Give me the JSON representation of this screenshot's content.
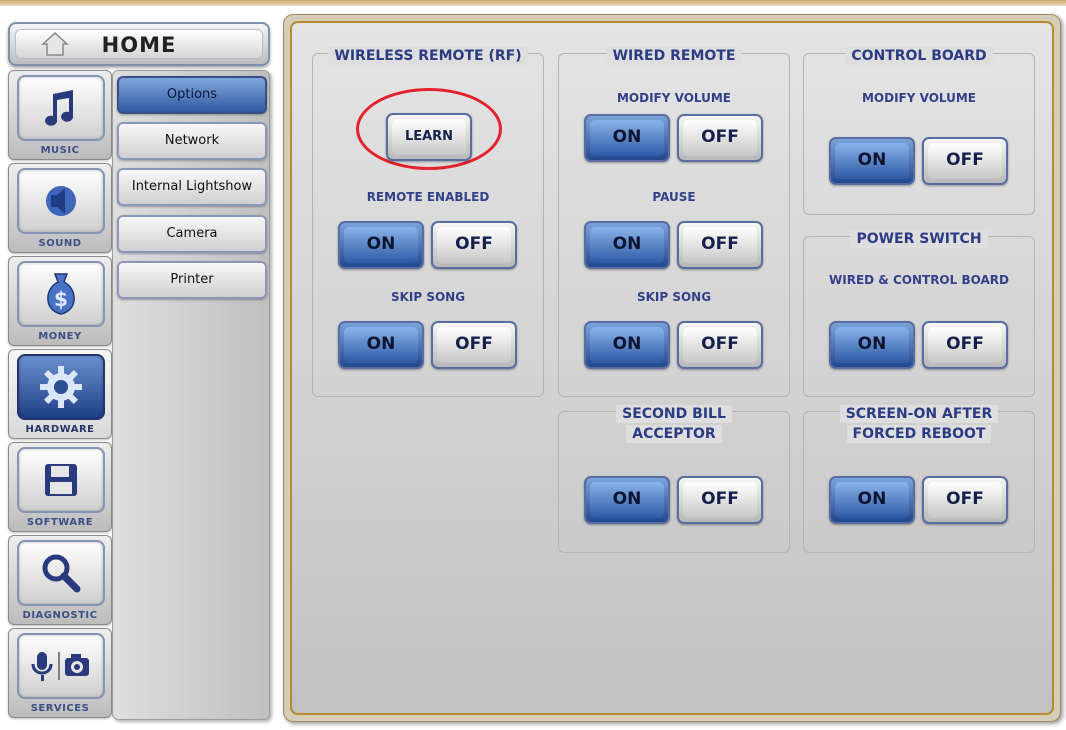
{
  "home": {
    "label": "HOME",
    "icon": "home-icon"
  },
  "categories": [
    {
      "label": "MUSIC",
      "icon": "music-icon"
    },
    {
      "label": "SOUND",
      "icon": "speaker-icon"
    },
    {
      "label": "MONEY",
      "icon": "money-bag-icon"
    },
    {
      "label": "HARDWARE",
      "icon": "gear-icon"
    },
    {
      "label": "SOFTWARE",
      "icon": "floppy-disk-icon"
    },
    {
      "label": "DIAGNOSTIC",
      "icon": "magnifier-icon"
    },
    {
      "label": "SERVICES",
      "icon": "mic-camera-icon"
    }
  ],
  "submenu": [
    "Options",
    "Network",
    "Internal Lightshow",
    "Camera",
    "Printer"
  ],
  "groups": {
    "wireless": {
      "title": "WIRELESS REMOTE (RF)",
      "learn": "LEARN",
      "remote_enabled": "REMOTE ENABLED",
      "skip_song": "SKIP SONG"
    },
    "wired": {
      "title": "WIRED REMOTE",
      "modify_volume": "MODIFY VOLUME",
      "pause": "PAUSE",
      "skip_song": "SKIP SONG"
    },
    "control": {
      "title": "CONTROL BOARD",
      "modify_volume": "MODIFY VOLUME"
    },
    "power": {
      "title": "POWER SWITCH",
      "wired_control": "WIRED & CONTROL BOARD"
    },
    "second_bill": {
      "title_line1": "SECOND BILL",
      "title_line2": "ACCEPTOR"
    },
    "screen_on": {
      "title_line1": "SCREEN-ON AFTER",
      "title_line2": "FORCED REBOOT"
    }
  },
  "toggle": {
    "on": "ON",
    "off": "OFF"
  },
  "colors": {
    "accent_blue": "#2d5aa6",
    "label_blue": "#2b3b84",
    "highlight_circle": "#e4222d",
    "frame_gold": "#b98a2f"
  }
}
